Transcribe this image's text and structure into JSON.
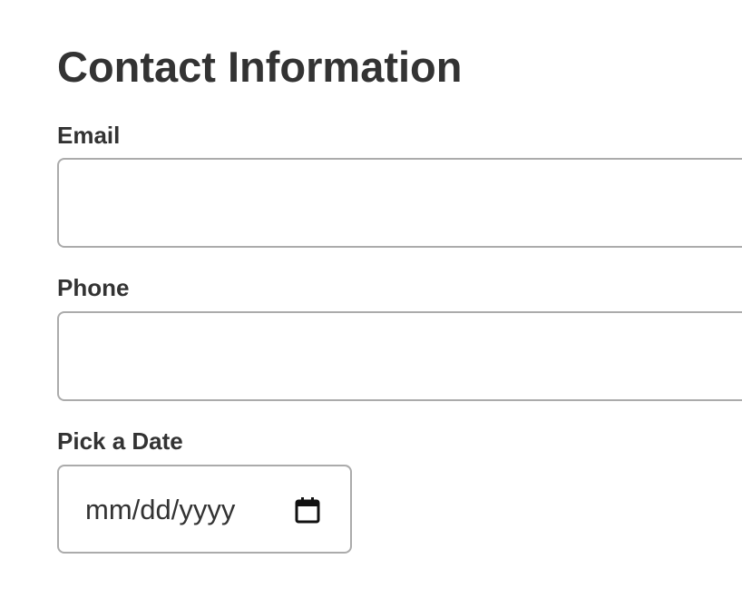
{
  "form": {
    "title": "Contact Information",
    "email": {
      "label": "Email",
      "value": "",
      "placeholder": ""
    },
    "phone": {
      "label": "Phone",
      "value": "",
      "placeholder": ""
    },
    "date": {
      "label": "Pick a Date",
      "placeholder": "mm/dd/yyyy",
      "icon": "calendar-icon"
    }
  },
  "colors": {
    "text": "#333333",
    "border": "#ababab",
    "background": "#ffffff"
  }
}
